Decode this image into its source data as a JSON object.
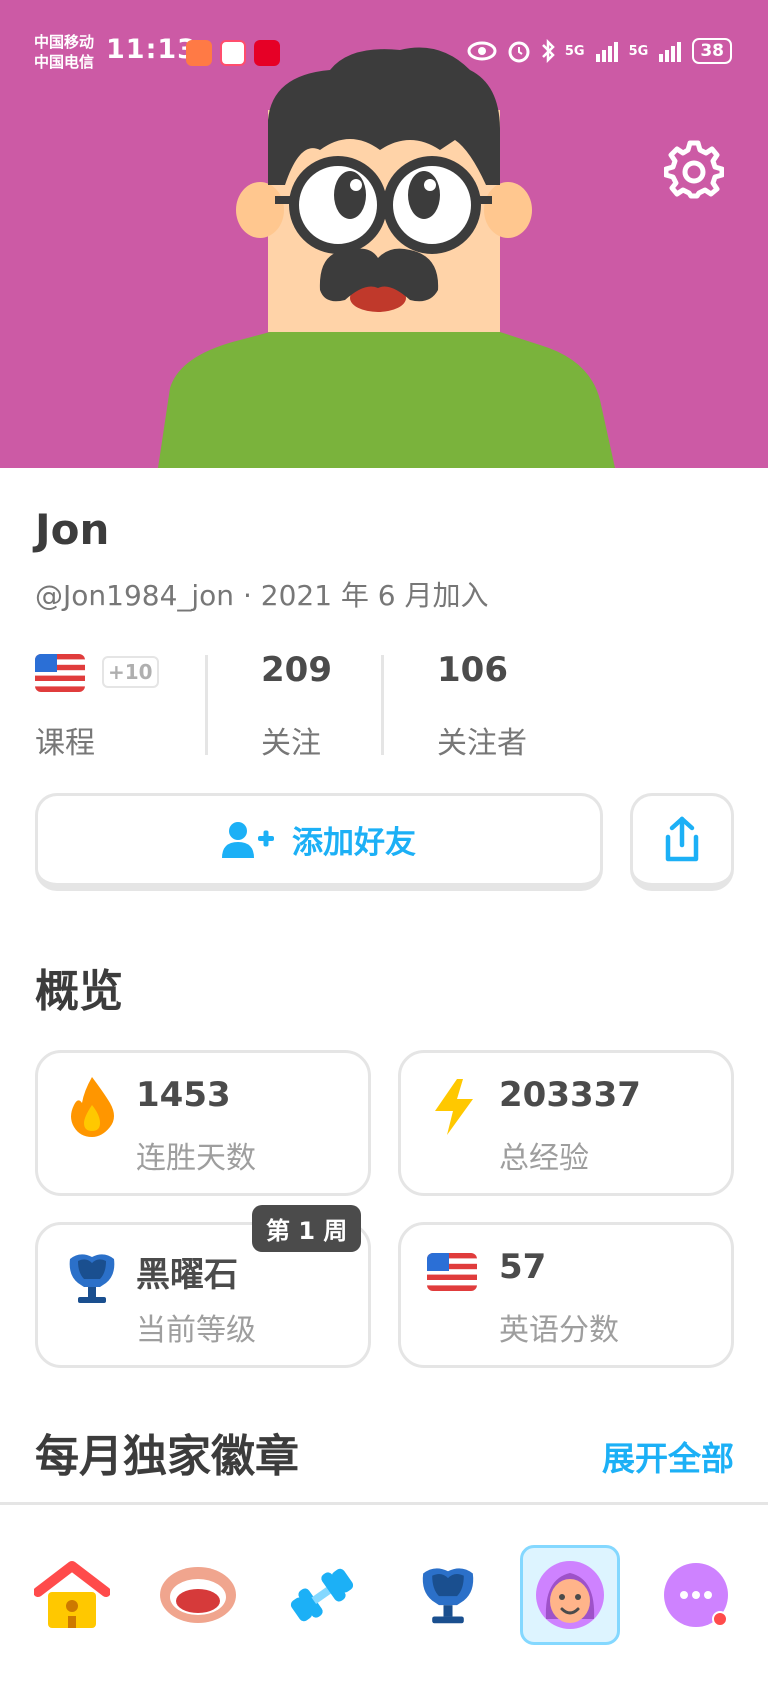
{
  "statusbar": {
    "carrier1": "中国移动",
    "carrier2": "中国电信",
    "time": "11:13",
    "net1": "5G",
    "net2": "5G",
    "battery": "38"
  },
  "profile": {
    "name": "Jon",
    "handle_joined": "@Jon1984_jon · 2021 年 6 月加入",
    "courses_extra": "+10",
    "courses_label": "课程",
    "following_count": "209",
    "following_label": "关注",
    "followers_count": "106",
    "followers_label": "关注者"
  },
  "actions": {
    "add_friend_label": "添加好友"
  },
  "overview": {
    "title": "概览",
    "streak_value": "1453",
    "streak_label": "连胜天数",
    "xp_value": "203337",
    "xp_label": "总经验",
    "league_value": "黑曜石",
    "league_label": "当前等级",
    "league_week_badge": "第 1 周",
    "score_value": "57",
    "score_label": "英语分数"
  },
  "badges": {
    "title": "每月独家徽章",
    "expand_label": "展开全部"
  },
  "tabbar": {
    "items": [
      {
        "icon": "home-icon"
      },
      {
        "icon": "speaking-icon"
      },
      {
        "icon": "practice-icon"
      },
      {
        "icon": "leaderboard-icon"
      },
      {
        "icon": "profile-icon",
        "active": true
      },
      {
        "icon": "more-icon",
        "has_notification": true
      }
    ]
  },
  "colors": {
    "banner": "#cc5aa5",
    "accent_blue": "#1cb0f6",
    "avatar_shirt": "#7ab33c",
    "avatar_skin": "#ffd3a8"
  }
}
